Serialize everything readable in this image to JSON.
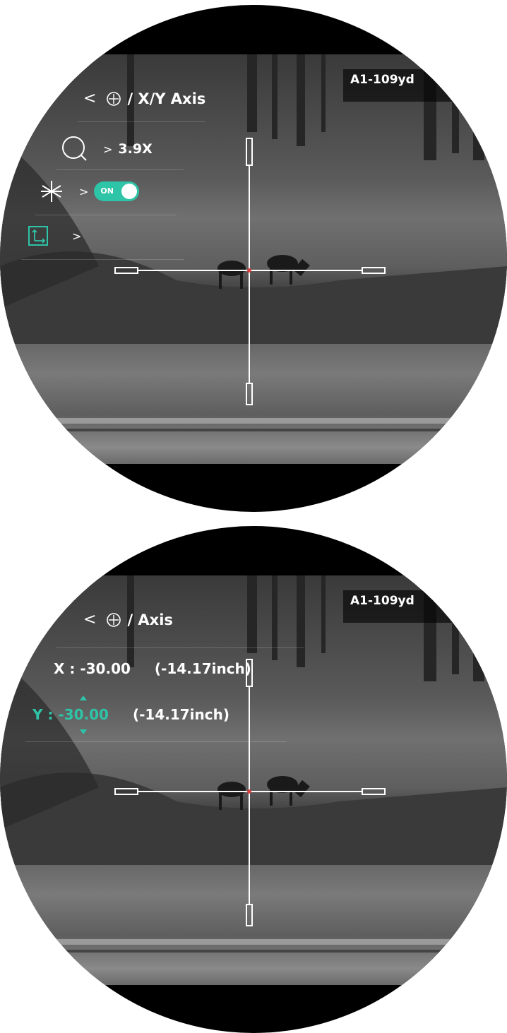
{
  "range_label": "A1-109yd",
  "screen1": {
    "title": "/ X/Y Axis",
    "zoom_value": "3.9X",
    "freeze_toggle": "ON"
  },
  "screen2": {
    "title": "/ Axis",
    "x_label": "X : -30.00",
    "x_inch": "(-14.17inch)",
    "y_label": "Y : -30.00",
    "y_inch": "(-14.17inch)"
  },
  "glyphs": {
    "back": "<",
    "chevron": ">"
  },
  "colors": {
    "accent": "#2ec4a7",
    "reticle_center": "#d94040"
  }
}
